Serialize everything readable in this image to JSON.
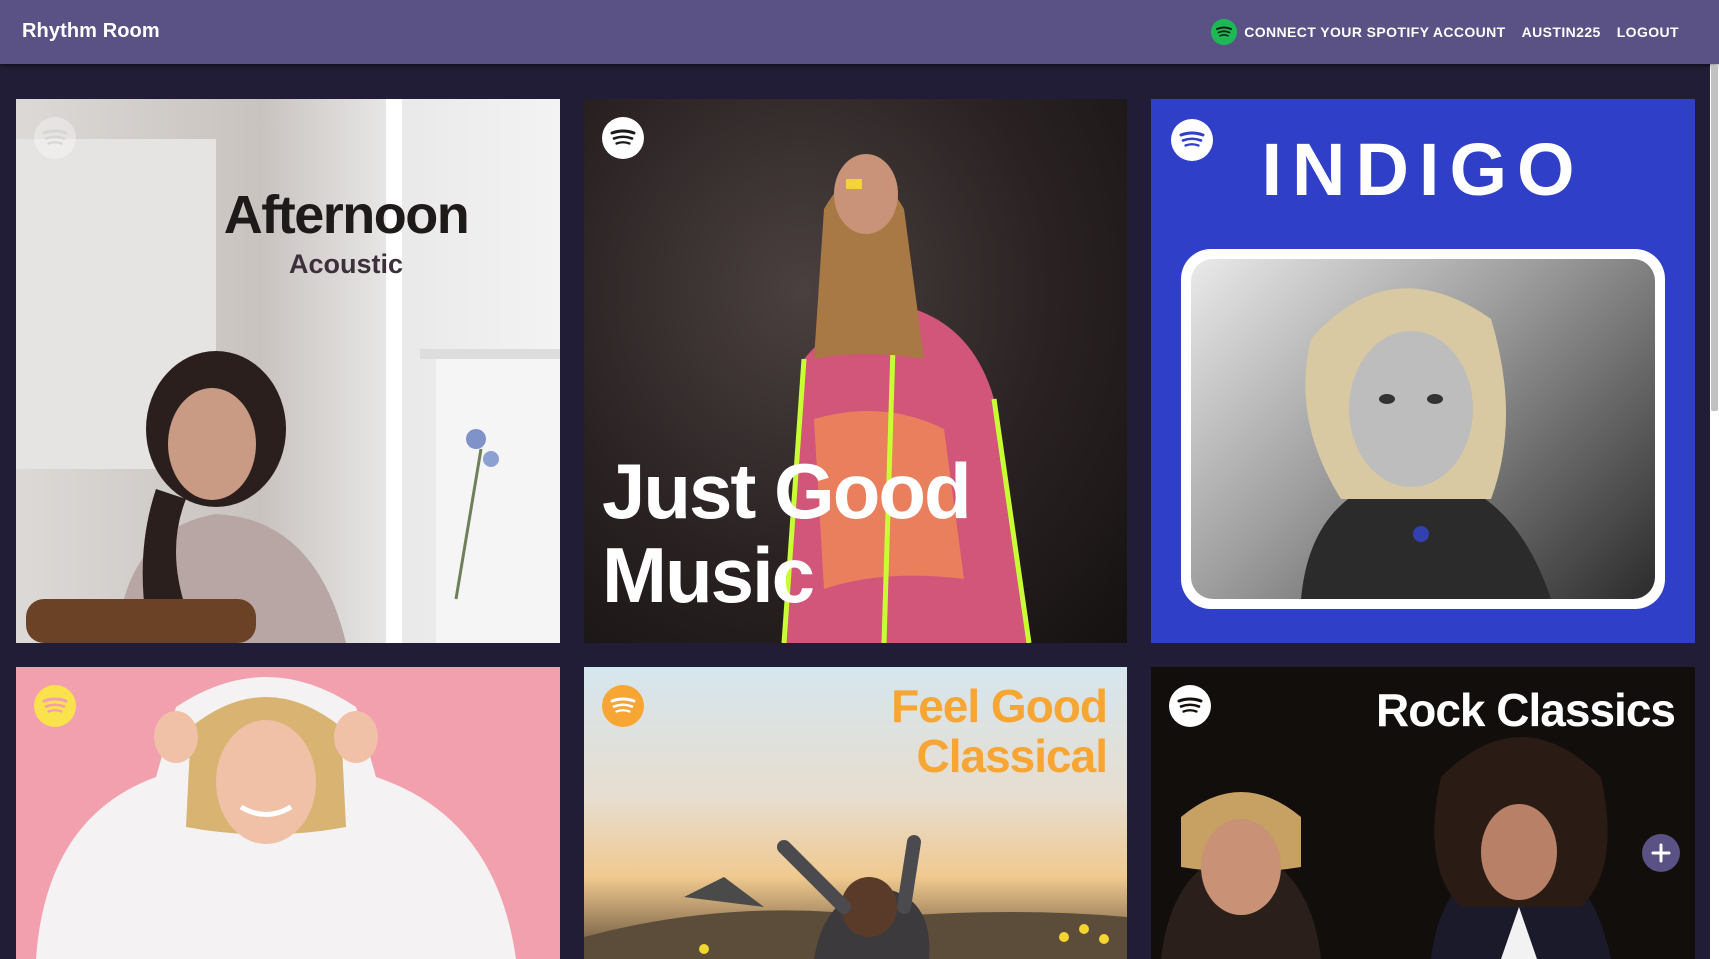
{
  "appbar": {
    "title": "Rhythm Room",
    "connect_label": "CONNECT YOUR SPOTIFY ACCOUNT",
    "username": "AUSTIN225",
    "logout_label": "LOGOUT"
  },
  "colors": {
    "appbar": "#5a5185",
    "background": "#221d36",
    "spotify_green": "#1db954"
  },
  "playlists": [
    {
      "title": "Afternoon",
      "subtitle": "Acoustic",
      "logo_icon": "spotify-icon"
    },
    {
      "title": "Just Good",
      "subtitle": "Music",
      "logo_icon": "spotify-icon"
    },
    {
      "title": "INDIGO",
      "logo_icon": "spotify-icon"
    },
    {
      "logo_icon": "spotify-icon"
    },
    {
      "title": "Feel Good",
      "subtitle": "Classical",
      "logo_icon": "spotify-icon"
    },
    {
      "title": "Rock Classics",
      "logo_icon": "spotify-icon"
    }
  ],
  "add_button_icon": "plus-icon"
}
